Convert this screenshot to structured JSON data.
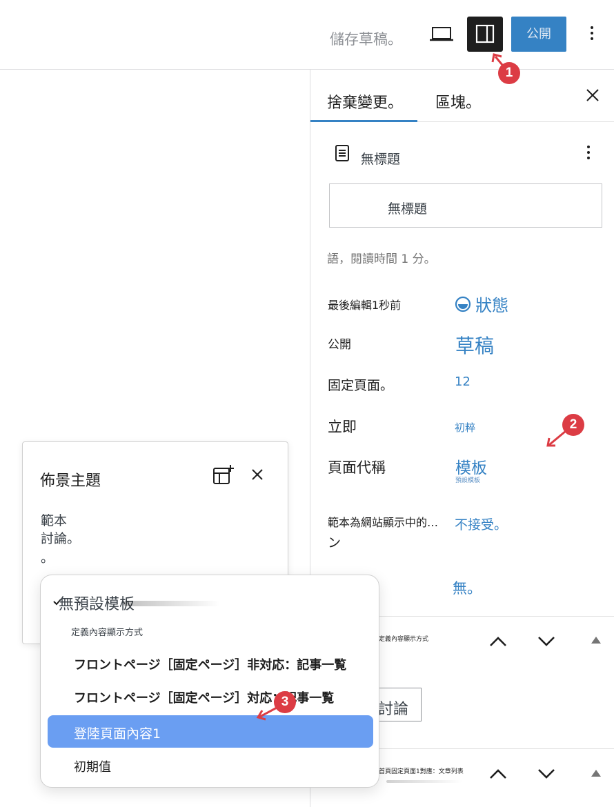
{
  "header": {
    "save_draft": "儲存草稿。",
    "publish": "公開"
  },
  "sidebar": {
    "tab_page": "捨棄變更。",
    "tab_block": "區塊。",
    "doc_title": "無標題",
    "title_input_value": "無標題",
    "read_time": "語，閱讀時間 1 分。",
    "rows": [
      {
        "label": "最後編輯1秒前",
        "value": "狀態"
      },
      {
        "label": "公開",
        "value": "草稿"
      },
      {
        "label": "固定頁面。",
        "value": "12"
      },
      {
        "label": "立即",
        "value": "初粹"
      },
      {
        "label": "頁面代稱",
        "value": "模板",
        "value_sub": "預設模板"
      },
      {
        "label": "範本為網站顯示中的…",
        "label2": "ン",
        "value": "不接受。"
      },
      {
        "label": "",
        "value": "無。"
      }
    ],
    "panel_captions": [
      "定義內容顯示方式",
      "首頁固定頁面1對應：文章列表"
    ],
    "discuss_button": "討論"
  },
  "layout_popover": {
    "title": "佈景主題",
    "line1": "範本",
    "line2": "討論。",
    "line3": "。"
  },
  "template_dropdown": {
    "selected": "無預設模板",
    "subtitle": "定義內容顯示方式",
    "options": [
      "フロントページ［固定ページ］非対応：記事一覧",
      "フロントページ［固定ページ］対応：記事一覧",
      "登陸頁面內容1",
      "初期值"
    ]
  },
  "annotations": [
    "1",
    "2",
    "3"
  ],
  "colors": {
    "accent": "#3582c4",
    "badge": "#dc3c44",
    "selected_option": "#6a9ef2"
  }
}
